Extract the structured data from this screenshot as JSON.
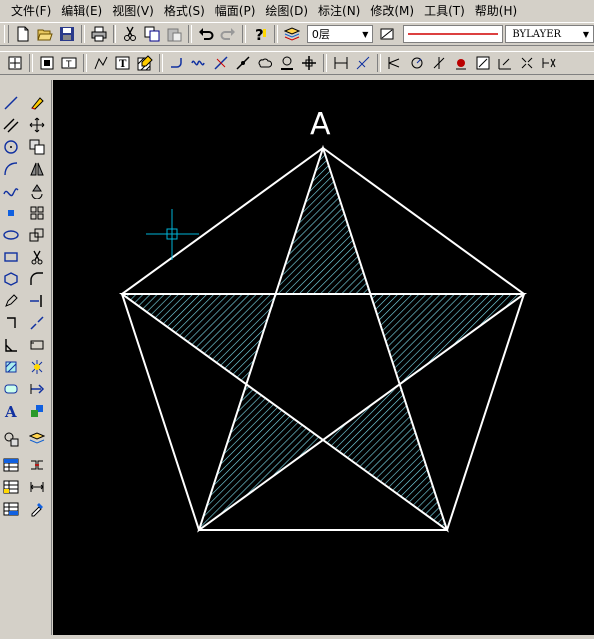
{
  "menubar": [
    "文件(F)",
    "编辑(E)",
    "视图(V)",
    "格式(S)",
    "幅面(P)",
    "绘图(D)",
    "标注(N)",
    "修改(M)",
    "工具(T)",
    "帮助(H)"
  ],
  "toolbar": {
    "layer_value": "0层",
    "linetype_value": "BYLAYER"
  },
  "drawing": {
    "vertex_label": "A"
  },
  "colors": {
    "canvas": "#000000",
    "lines": "#ffffff",
    "hatch": "#7fe0f0",
    "crosshair": "#00b4d8"
  },
  "icons": {
    "standard": [
      "new-file-icon",
      "open-folder-icon",
      "save-icon",
      "print-icon",
      "cut-icon",
      "copy-icon",
      "paste-icon",
      "undo-icon",
      "redo-icon",
      "help-icon",
      "layer-icon",
      "linetype-icon"
    ],
    "modify": [
      "zoom-window-icon",
      "zoom-all-icon",
      "text-style-icon",
      "polyline-edit-icon",
      "text-edit-icon",
      "hatch-edit-icon",
      "fillet-icon",
      "wave-icon",
      "trim-icon",
      "break-icon",
      "cloud-icon",
      "block-icon",
      "move-icon",
      "dim-linear-icon",
      "dim-aligned-icon",
      "dim-angular-icon",
      "dim-radius-icon",
      "dim-diameter-icon",
      "dim-ordinate-icon",
      "dim-leader-icon",
      "dim-baseline-icon",
      "dim-continue-icon",
      "dim-edit-icon"
    ],
    "draw_left": [
      "line-icon",
      "double-line-icon",
      "circle-icon",
      "arc-icon",
      "spline-icon",
      "point-icon",
      "ellipse-icon",
      "rectangle-icon",
      "polygon-icon",
      "pencil-icon",
      "bracket-icon",
      "angle-icon",
      "hatch-box-icon",
      "region-icon",
      "text-icon",
      "insert-icon",
      "table-icon",
      "table2-icon",
      "table3-icon"
    ],
    "modify_left": [
      "eraser-icon",
      "move-arrows-icon",
      "copy-objects-icon",
      "mirror-icon",
      "rotate-icon",
      "array-icon",
      "scale-icon",
      "scissors-icon",
      "fillet-arc-icon",
      "extend-icon",
      "break-line-icon",
      "stretch-icon",
      "explode-icon",
      "align-icon",
      "layer-change-icon",
      "layer-props-icon",
      "join-icon",
      "measure-icon",
      "eyedropper-icon"
    ]
  }
}
